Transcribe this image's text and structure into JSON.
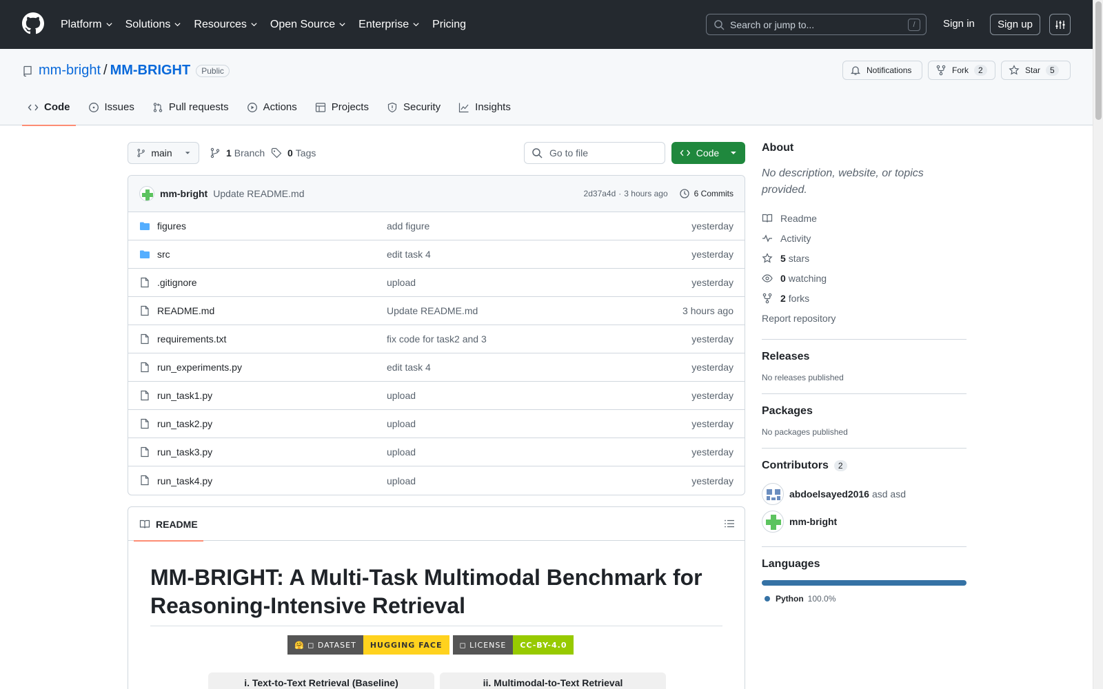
{
  "header": {
    "nav": [
      "Platform",
      "Solutions",
      "Resources",
      "Open Source",
      "Enterprise",
      "Pricing"
    ],
    "search_placeholder": "Search or jump to...",
    "search_shortcut": "/",
    "sign_in": "Sign in",
    "sign_up": "Sign up"
  },
  "repo": {
    "owner": "mm-bright",
    "separator": "/",
    "name": "MM-BRIGHT",
    "visibility": "Public",
    "notifications_label": "Notifications",
    "fork_label": "Fork",
    "fork_count": "2",
    "star_label": "Star",
    "star_count": "5"
  },
  "tabs": [
    "Code",
    "Issues",
    "Pull requests",
    "Actions",
    "Projects",
    "Security",
    "Insights"
  ],
  "toolbar": {
    "branch": "main",
    "branches_count": "1",
    "branches_label": "Branch",
    "tags_count": "0",
    "tags_label": "Tags",
    "goto_placeholder": "Go to file",
    "code_label": "Code"
  },
  "latest_commit": {
    "user": "mm-bright",
    "message": "Update README.md",
    "hash": "2d37a4d",
    "separator": "·",
    "time": "3 hours ago",
    "commits_label": "6 Commits"
  },
  "files": [
    {
      "name": "figures",
      "type": "dir",
      "message": "add figure",
      "time": "yesterday"
    },
    {
      "name": "src",
      "type": "dir",
      "message": "edit task 4",
      "time": "yesterday"
    },
    {
      "name": ".gitignore",
      "type": "file",
      "message": "upload",
      "time": "yesterday"
    },
    {
      "name": "README.md",
      "type": "file",
      "message": "Update README.md",
      "time": "3 hours ago"
    },
    {
      "name": "requirements.txt",
      "type": "file",
      "message": "fix code for task2 and 3",
      "time": "yesterday"
    },
    {
      "name": "run_experiments.py",
      "type": "file",
      "message": "edit task 4",
      "time": "yesterday"
    },
    {
      "name": "run_task1.py",
      "type": "file",
      "message": "upload",
      "time": "yesterday"
    },
    {
      "name": "run_task2.py",
      "type": "file",
      "message": "upload",
      "time": "yesterday"
    },
    {
      "name": "run_task3.py",
      "type": "file",
      "message": "upload",
      "time": "yesterday"
    },
    {
      "name": "run_task4.py",
      "type": "file",
      "message": "upload",
      "time": "yesterday"
    }
  ],
  "readme": {
    "tab_label": "README",
    "title": "MM-BRIGHT: A Multi-Task Multimodal Benchmark for Reasoning-Intensive Retrieval",
    "badges": [
      {
        "left": "🤗 ◻ DATASET",
        "right": "HUGGING FACE"
      },
      {
        "left": "◻ LICENSE",
        "right": "CC-BY-4.0"
      }
    ],
    "figure_headers": [
      "i. Text-to-Text Retrieval (Baseline)",
      "ii. Multimodal-to-Text Retrieval"
    ]
  },
  "sidebar": {
    "about_title": "About",
    "about_desc": "No description, website, or topics provided.",
    "links": [
      {
        "icon": "book-icon",
        "bold": "",
        "label": "Readme"
      },
      {
        "icon": "pulse-icon",
        "bold": "",
        "label": "Activity"
      },
      {
        "icon": "star-icon",
        "bold": "5",
        "label": "stars"
      },
      {
        "icon": "eye-icon",
        "bold": "0",
        "label": "watching"
      },
      {
        "icon": "fork-icon",
        "bold": "2",
        "label": "forks"
      }
    ],
    "report": "Report repository",
    "releases_title": "Releases",
    "releases_text": "No releases published",
    "packages_title": "Packages",
    "packages_text": "No packages published",
    "contributors_title": "Contributors",
    "contributors_count": "2",
    "contributors": [
      {
        "login": "abdoelsayed2016",
        "name": "asd asd"
      },
      {
        "login": "mm-bright",
        "name": ""
      }
    ],
    "languages_title": "Languages",
    "languages": [
      {
        "name": "Python",
        "percent": "100.0%",
        "color": "#3572A5"
      }
    ]
  }
}
